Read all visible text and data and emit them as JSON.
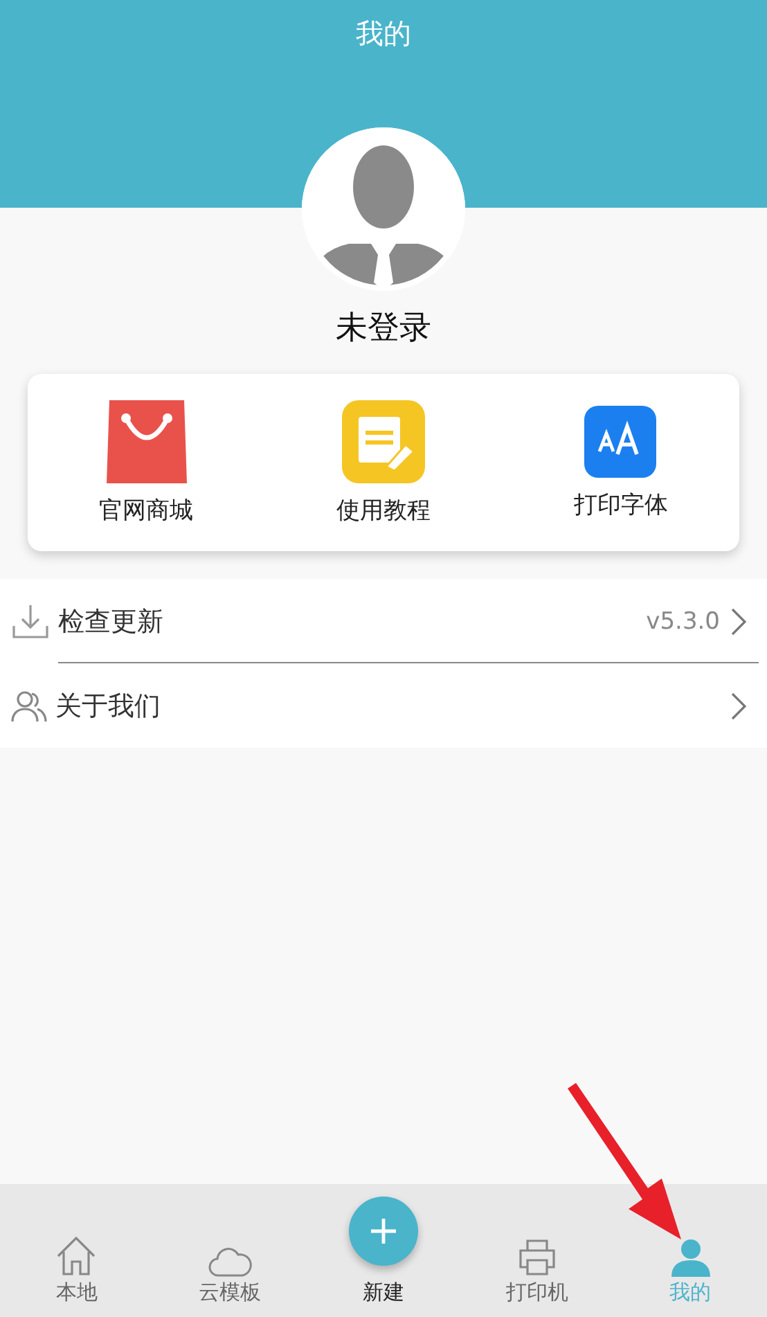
{
  "header": {
    "title": "我的"
  },
  "profile": {
    "name": "未登录"
  },
  "shortcuts": [
    {
      "kind": "shop",
      "label": "官网商城"
    },
    {
      "kind": "tutorial",
      "label": "使用教程"
    },
    {
      "kind": "font",
      "label": "打印字体"
    }
  ],
  "menu": [
    {
      "kind": "update",
      "label": "检查更新",
      "value": "v5.3.0"
    },
    {
      "kind": "about",
      "label": "关于我们"
    }
  ],
  "tab_bar": [
    {
      "kind": "home",
      "label": "本地",
      "selected": false
    },
    {
      "kind": "cloud",
      "label": "云模板",
      "selected": false
    },
    {
      "kind": "create",
      "label": "新建",
      "selected": false
    },
    {
      "kind": "printer",
      "label": "打印机",
      "selected": false
    },
    {
      "kind": "user",
      "label": "我的",
      "selected": true
    }
  ]
}
